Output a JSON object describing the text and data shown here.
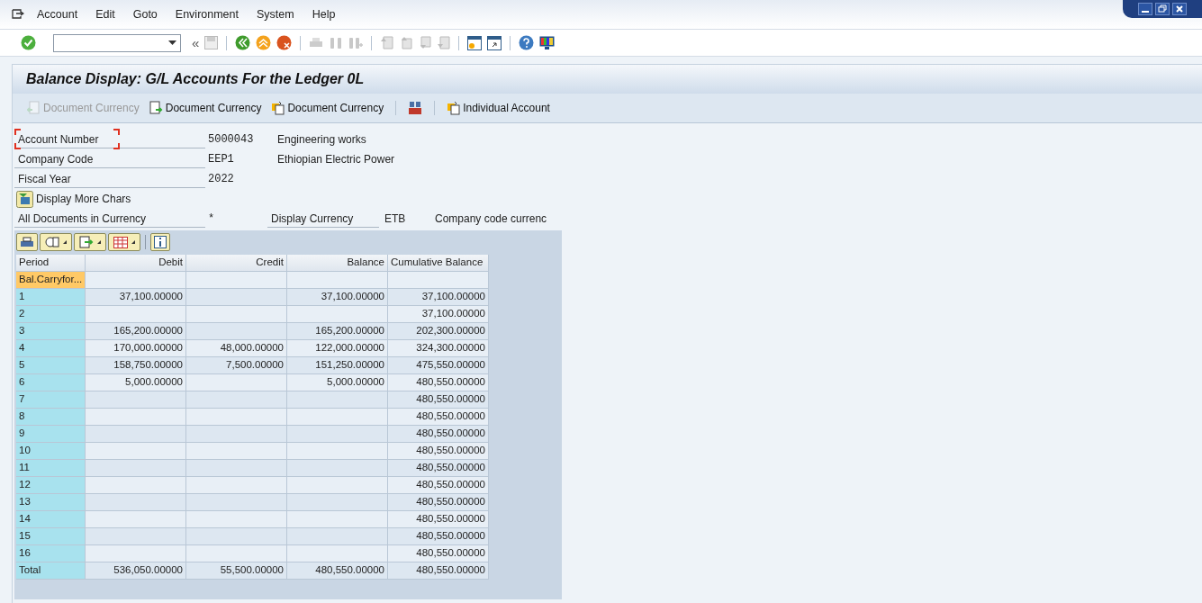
{
  "menu": [
    "Account",
    "Edit",
    "Goto",
    "Environment",
    "System",
    "Help"
  ],
  "collapse_symbol": "«",
  "title": "Balance Display: G/L Accounts For the Ledger 0L",
  "app_toolbar": [
    {
      "label": "Document Currency",
      "disabled": true,
      "kind": "prev"
    },
    {
      "label": "Document Currency",
      "disabled": false,
      "kind": "next"
    },
    {
      "label": "Document Currency",
      "disabled": false,
      "kind": "switch"
    },
    {
      "disabled": false,
      "kind": "currency"
    },
    {
      "label": "Individual Account",
      "disabled": false,
      "kind": "switch"
    }
  ],
  "fields": [
    {
      "label": "Account Number",
      "value": "5000043",
      "description": "Engineering works",
      "focused": true
    },
    {
      "label": "Company Code",
      "value": "EEP1",
      "description": "Ethiopian Electric Power",
      "focused": false
    },
    {
      "label": "Fiscal Year",
      "value": "2022",
      "focused": false
    }
  ],
  "more_button": "Display More Chars",
  "currency_row": {
    "label": "All Documents in Currency",
    "value": "*",
    "display_label": "Display Currency",
    "display_value": "ETB",
    "display_description": "Company code currenc"
  },
  "table": {
    "columns": [
      "Period",
      "Debit",
      "Credit",
      "Balance",
      "Cumulative Balance"
    ],
    "rows": [
      {
        "cells": [
          "Bal.Carryfor...",
          "",
          "",
          "",
          ""
        ],
        "selected": true
      },
      {
        "cells": [
          "1",
          "37,100.00000",
          "",
          "37,100.00000",
          "37,100.00000"
        ],
        "selected": false
      },
      {
        "cells": [
          "2",
          "",
          "",
          "",
          "37,100.00000"
        ],
        "selected": false
      },
      {
        "cells": [
          "3",
          "165,200.00000",
          "",
          "165,200.00000",
          "202,300.00000"
        ],
        "selected": false
      },
      {
        "cells": [
          "4",
          "170,000.00000",
          "48,000.00000",
          "122,000.00000",
          "324,300.00000"
        ],
        "selected": false
      },
      {
        "cells": [
          "5",
          "158,750.00000",
          "7,500.00000",
          "151,250.00000",
          "475,550.00000"
        ],
        "selected": false
      },
      {
        "cells": [
          "6",
          "5,000.00000",
          "",
          "5,000.00000",
          "480,550.00000"
        ],
        "selected": false
      },
      {
        "cells": [
          "7",
          "",
          "",
          "",
          "480,550.00000"
        ],
        "selected": false
      },
      {
        "cells": [
          "8",
          "",
          "",
          "",
          "480,550.00000"
        ],
        "selected": false
      },
      {
        "cells": [
          "9",
          "",
          "",
          "",
          "480,550.00000"
        ],
        "selected": false
      },
      {
        "cells": [
          "10",
          "",
          "",
          "",
          "480,550.00000"
        ],
        "selected": false
      },
      {
        "cells": [
          "11",
          "",
          "",
          "",
          "480,550.00000"
        ],
        "selected": false
      },
      {
        "cells": [
          "12",
          "",
          "",
          "",
          "480,550.00000"
        ],
        "selected": false
      },
      {
        "cells": [
          "13",
          "",
          "",
          "",
          "480,550.00000"
        ],
        "selected": false
      },
      {
        "cells": [
          "14",
          "",
          "",
          "",
          "480,550.00000"
        ],
        "selected": false
      },
      {
        "cells": [
          "15",
          "",
          "",
          "",
          "480,550.00000"
        ],
        "selected": false
      },
      {
        "cells": [
          "16",
          "",
          "",
          "",
          "480,550.00000"
        ],
        "selected": false
      },
      {
        "cells": [
          "Total",
          "536,050.00000",
          "55,500.00000",
          "480,550.00000",
          "480,550.00000"
        ],
        "selected": false
      }
    ]
  }
}
